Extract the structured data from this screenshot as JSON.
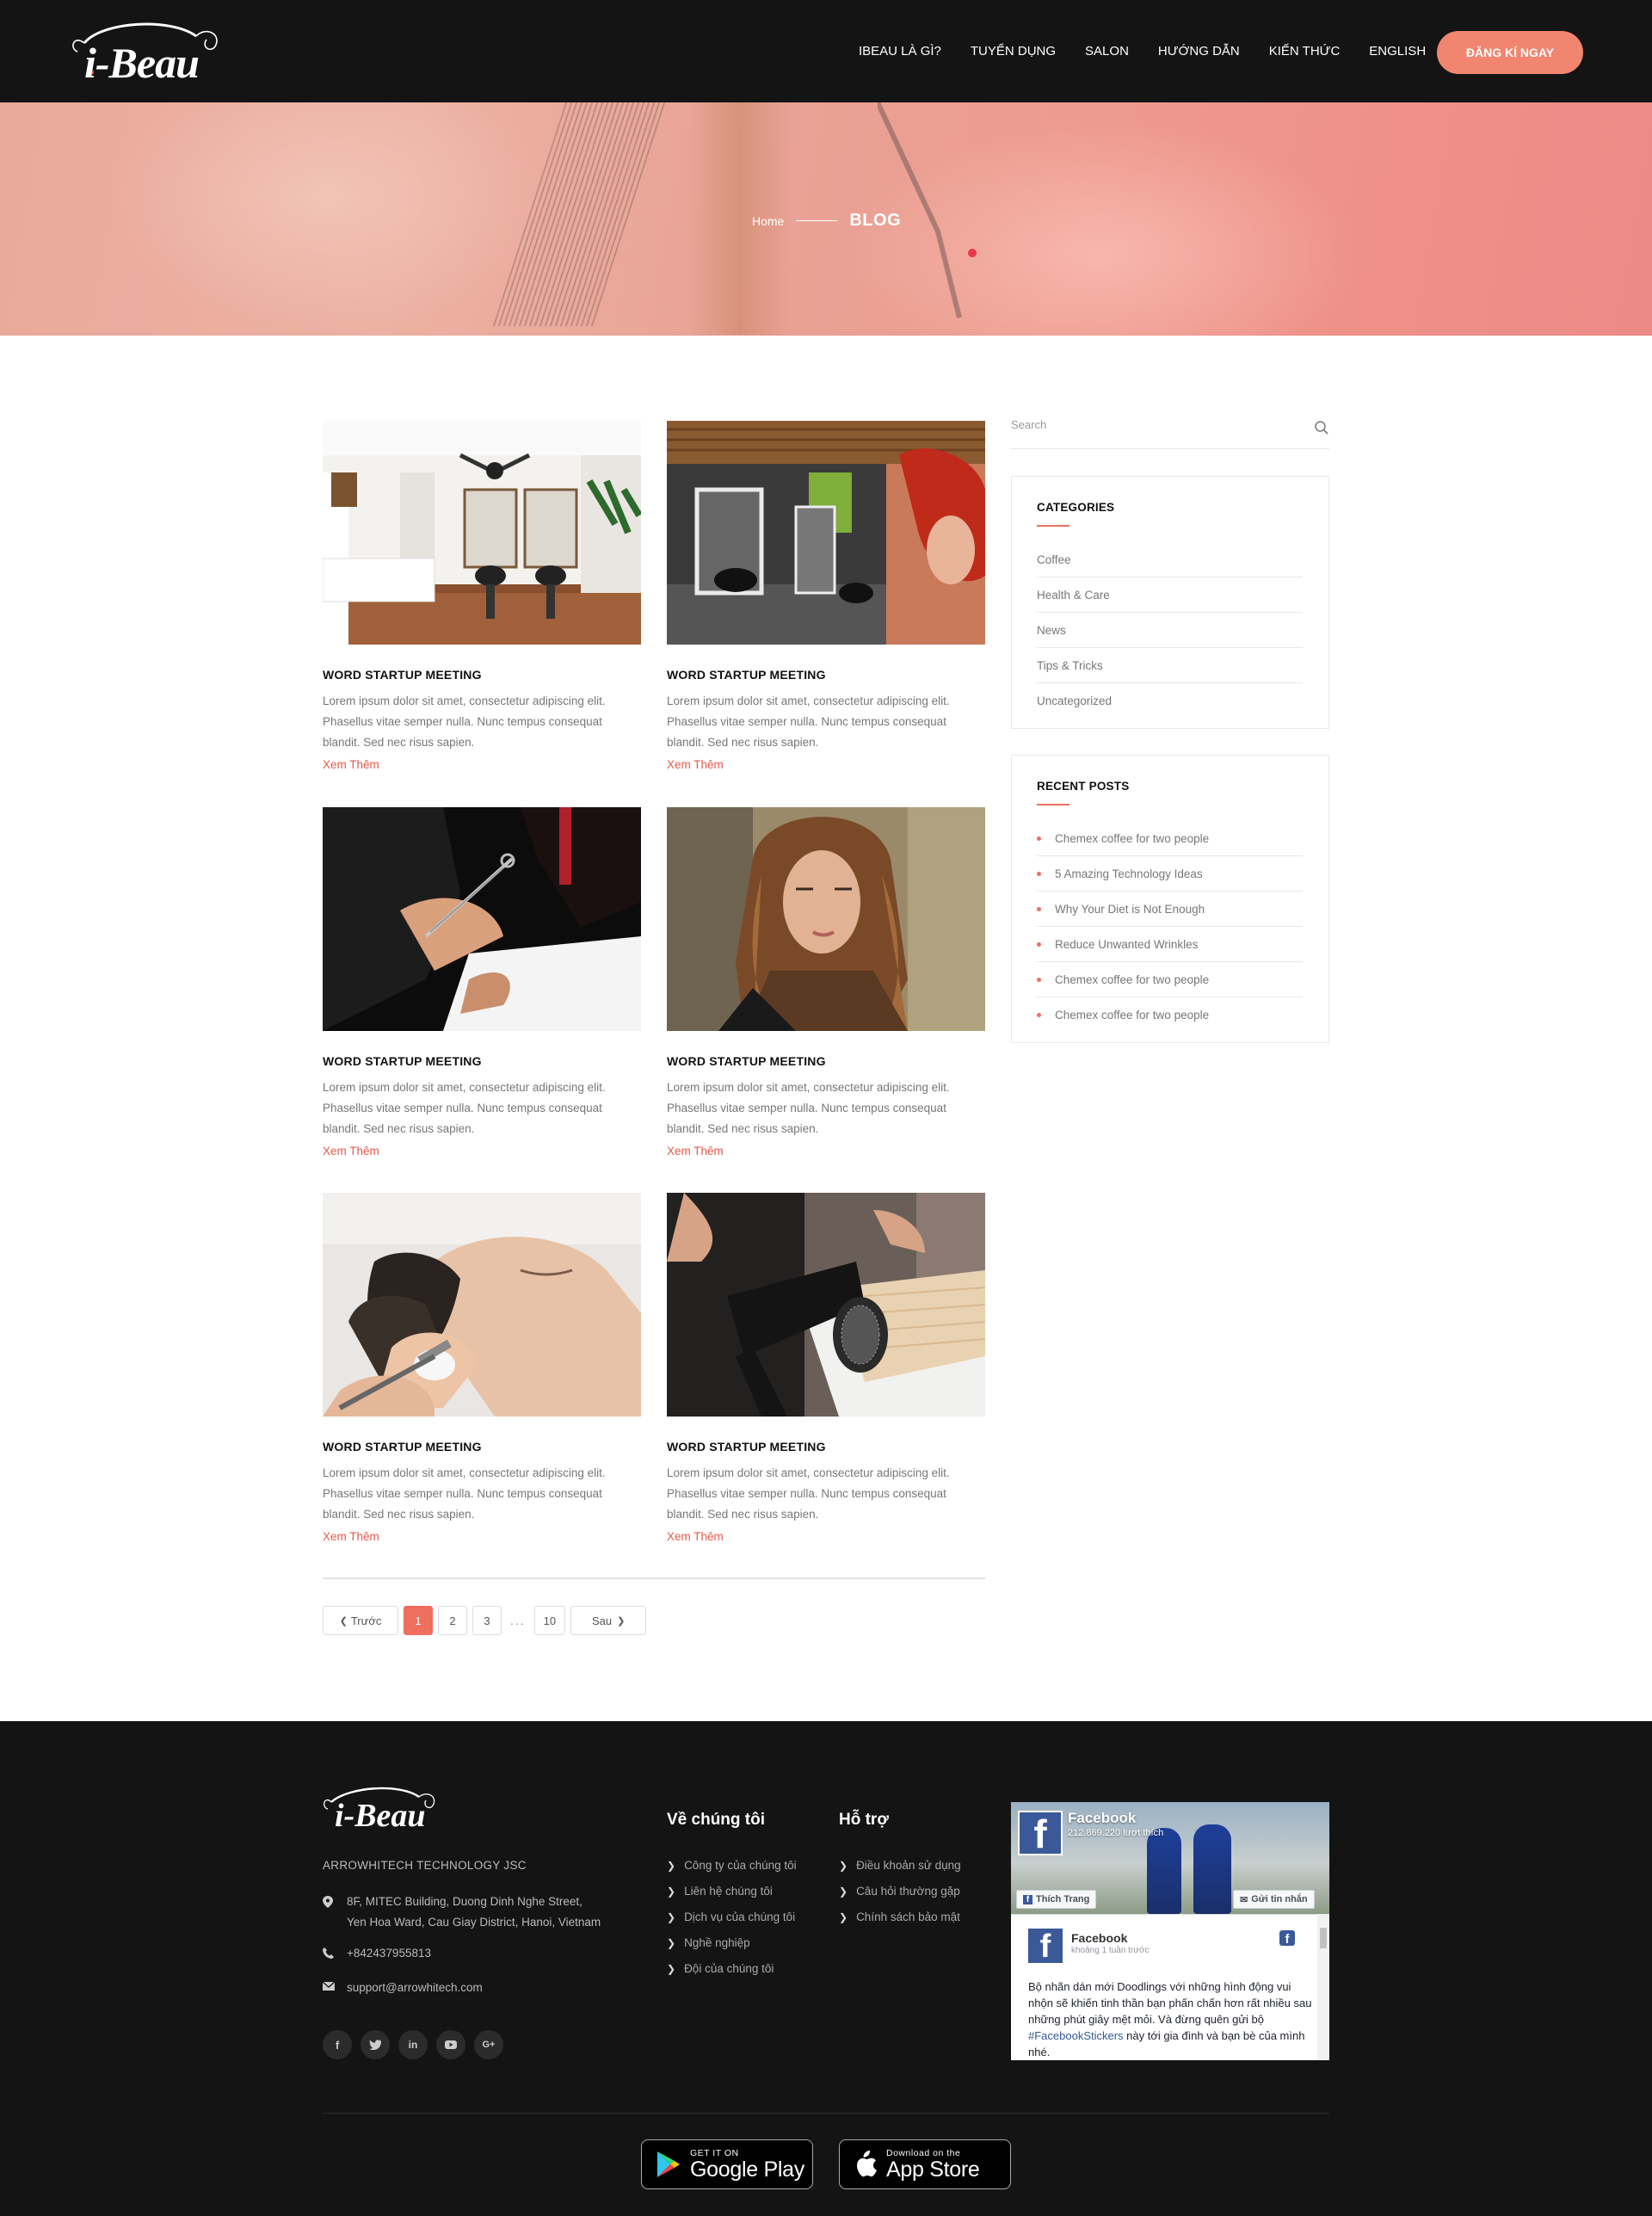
{
  "header": {
    "logo_text": "i-Beau",
    "nav": [
      {
        "label": "IBEAU LÀ GÌ?"
      },
      {
        "label": "TUYỂN DỤNG"
      },
      {
        "label": "SALON"
      },
      {
        "label": "HƯỚNG DẪN"
      },
      {
        "label": "KIẾN THỨC"
      },
      {
        "label": "ENGLISH"
      }
    ],
    "cta_label": "ĐĂNG KÍ NGAY"
  },
  "hero": {
    "breadcrumb_home": "Home",
    "breadcrumb_current": "BLOG"
  },
  "posts": [
    {
      "title": "WORD STARTUP MEETING",
      "excerpt": "Lorem ipsum dolor sit amet, consectetur adipiscing elit. Phasellus vitae semper nulla. Nunc tempus consequat blandit. Sed nec risus sapien.",
      "more": "Xem Thêm",
      "image": "salon-interior-white"
    },
    {
      "title": "WORD STARTUP MEETING",
      "excerpt": "Lorem ipsum dolor sit amet, consectetur adipiscing elit. Phasellus vitae semper nulla. Nunc tempus consequat blandit. Sed nec risus sapien.",
      "more": "Xem Thêm",
      "image": "salon-interior-dark"
    },
    {
      "title": "WORD STARTUP MEETING",
      "excerpt": "Lorem ipsum dolor sit amet, consectetur adipiscing elit. Phasellus vitae semper nulla. Nunc tempus consequat blandit. Sed nec risus sapien.",
      "more": "Xem Thêm",
      "image": "haircut-scissors"
    },
    {
      "title": "WORD STARTUP MEETING",
      "excerpt": "Lorem ipsum dolor sit amet, consectetur adipiscing elit. Phasellus vitae semper nulla. Nunc tempus consequat blandit. Sed nec risus sapien.",
      "more": "Xem Thêm",
      "image": "woman-wavy-hair"
    },
    {
      "title": "WORD STARTUP MEETING",
      "excerpt": "Lorem ipsum dolor sit amet, consectetur adipiscing elit. Phasellus vitae semper nulla. Nunc tempus consequat blandit. Sed nec risus sapien.",
      "more": "Xem Thêm",
      "image": "hair-wash"
    },
    {
      "title": "WORD STARTUP MEETING",
      "excerpt": "Lorem ipsum dolor sit amet, consectetur adipiscing elit. Phasellus vitae semper nulla. Nunc tempus consequat blandit. Sed nec risus sapien.",
      "more": "Xem Thêm",
      "image": "hair-dryer-brush"
    }
  ],
  "pagination": {
    "prev": "Trước",
    "pages": [
      "1",
      "2",
      "3"
    ],
    "ellipsis": "...",
    "last": "10",
    "next": "Sau",
    "current": "1"
  },
  "sidebar": {
    "search_placeholder": "Search",
    "categories_title": "CATEGORIES",
    "categories": [
      "Coffee",
      "Health & Care",
      "News",
      "Tips & Tricks",
      "Uncategorized"
    ],
    "recent_title": "RECENT POSTS",
    "recent": [
      "Chemex coffee for two people",
      "5 Amazing Technology Ideas",
      "Why Your Diet is Not Enough",
      "Reduce Unwanted Wrinkles",
      "Chemex coffee for two people",
      "Chemex coffee for two people"
    ]
  },
  "footer": {
    "logo_text": "i-Beau",
    "company": "ARROWHITECH TECHNOLOGY JSC",
    "address_line1": "8F, MITEC Building, Duong Dinh Nghe Street,",
    "address_line2": "Yen Hoa Ward, Cau Giay District, Hanoi, Vietnam",
    "phone": "+842437955813",
    "email": "support@arrowhitech.com",
    "socials": [
      "facebook-icon",
      "twitter-icon",
      "linkedin-icon",
      "youtube-icon",
      "google-plus-icon"
    ],
    "about_title": "Về chúng tôi",
    "about_links": [
      "Công ty của chúng tôi",
      "Liên hệ chúng tôi",
      "Dịch vụ của chúng tôi",
      "Nghề nghiệp",
      "Đội của chúng tôi"
    ],
    "support_title": "Hỗ trợ",
    "support_links": [
      "Điều khoản sử dụng",
      "Câu hỏi thường gặp",
      "Chính sách bảo mật"
    ],
    "facebook": {
      "name": "Facebook",
      "likes": "212.869.220 lượt thích",
      "like_button": "Thích Trang",
      "message_button": "Gửi tin nhắn",
      "post_name": "Facebook",
      "post_time": "khoảng 1 tuần trước",
      "post_text": "Bộ nhãn dán mới Doodlings với những hình động vui nhộn sẽ khiến tinh thần bạn phấn chấn hơn rất nhiều sau những phút giây mệt mỏi. Và đừng quên gửi bộ ",
      "post_tag": "#FacebookStickers",
      "post_text_end": " này tới gia đình và bạn bè của mình nhé."
    },
    "google_play_small": "GET IT ON",
    "google_play_big": "Google Play",
    "app_store_small": "Download on the",
    "app_store_big": "App Store"
  },
  "colors": {
    "accent": "#ee6f5e",
    "header_bg": "#141414",
    "cta_bg": "#f1856f"
  }
}
